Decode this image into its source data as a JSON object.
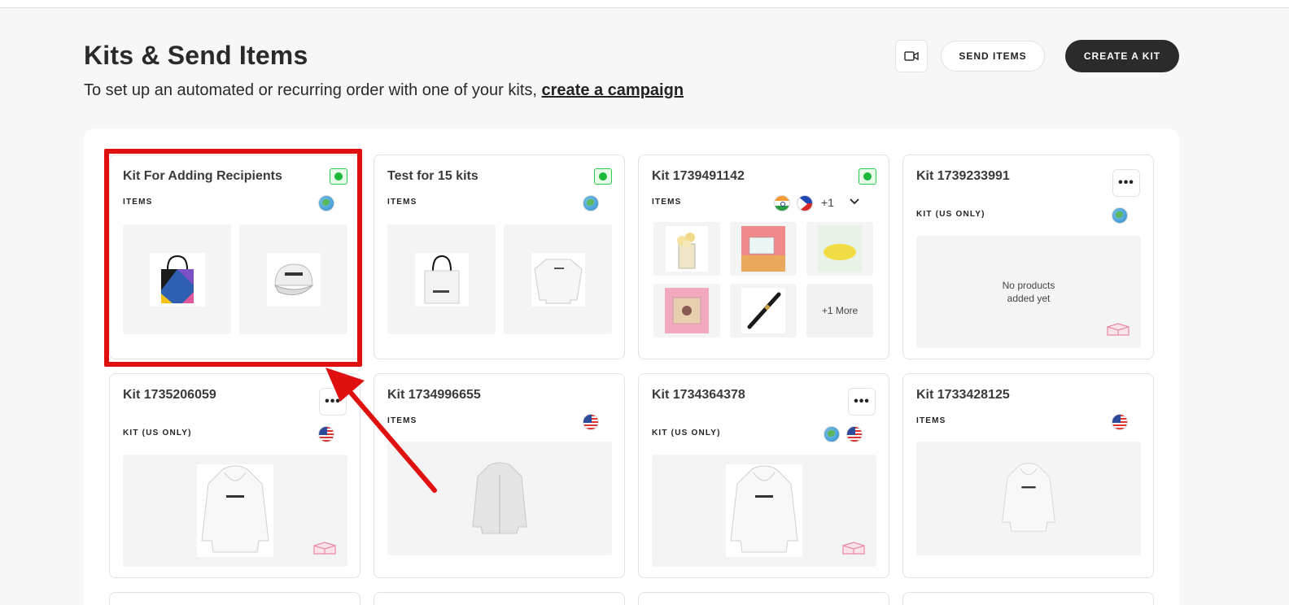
{
  "header": {
    "title": "Kits & Send Items",
    "subtitle_prefix": "To set up an automated or recurring order with one of your kits, ",
    "subtitle_link": "create a campaign",
    "send_items_label": "SEND ITEMS",
    "create_kit_label": "CREATE A KIT",
    "video_icon": "video-camera-icon"
  },
  "cards": [
    {
      "title": "Kit For Adding Recipients",
      "label": "ITEMS",
      "status": "active",
      "regions": [
        "global"
      ],
      "items": [
        "tote-bag",
        "cap"
      ],
      "highlighted": true
    },
    {
      "title": "Test for 15 kits",
      "label": "ITEMS",
      "status": "active",
      "regions": [
        "global"
      ],
      "items": [
        "tote-bag-white",
        "sweatshirt"
      ]
    },
    {
      "title": "Kit 1739491142",
      "label": "ITEMS",
      "status": "active",
      "regions": [
        "india",
        "philippines"
      ],
      "region_more": "+1",
      "items": [
        "popcorn",
        "gift-card",
        "eye-mask",
        "gift-box",
        "pen"
      ],
      "more_items": "+1 More"
    },
    {
      "title": "Kit 1739233991",
      "label": "KIT (US ONLY)",
      "regions": [
        "global"
      ],
      "empty_text": "No products added yet"
    },
    {
      "title": "Kit 1735206059",
      "label": "KIT (US ONLY)",
      "regions": [
        "us"
      ],
      "items": [
        "hoodie"
      ]
    },
    {
      "title": "Kit 1734996655",
      "label": "ITEMS",
      "regions": [
        "us"
      ],
      "items": [
        "jacket"
      ]
    },
    {
      "title": "Kit 1734364378",
      "label": "KIT (US ONLY)",
      "regions": [
        "global",
        "us"
      ],
      "items": [
        "hoodie"
      ]
    },
    {
      "title": "Kit 1733428125",
      "label": "ITEMS",
      "regions": [
        "us"
      ],
      "items": [
        "hoodie"
      ]
    }
  ],
  "colors": {
    "accent_dark": "#2b2b2b",
    "status_green": "#1db83a",
    "highlight_red": "#e01010"
  }
}
